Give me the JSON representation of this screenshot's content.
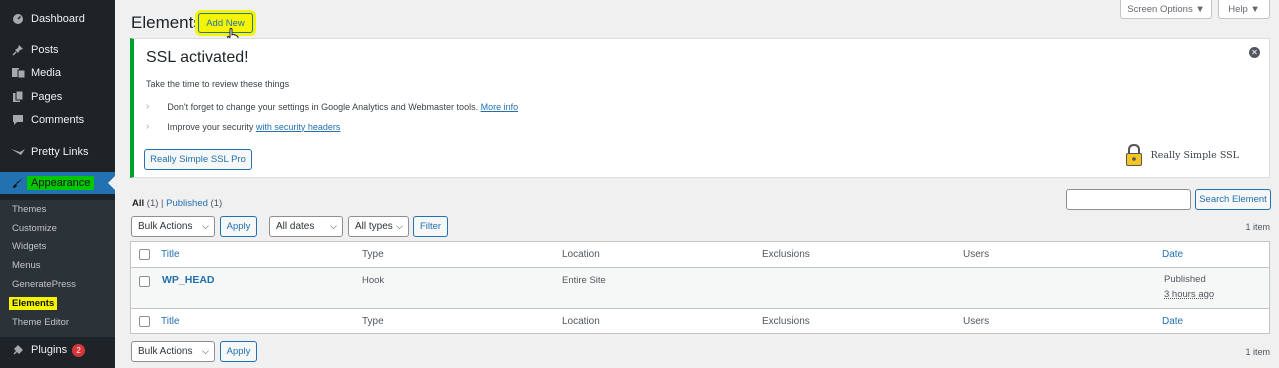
{
  "sidebar": {
    "items": [
      {
        "label": "Dashboard",
        "icon": "dashboard-icon"
      },
      {
        "label": "Posts",
        "icon": "pin-icon"
      },
      {
        "label": "Media",
        "icon": "media-icon"
      },
      {
        "label": "Pages",
        "icon": "pages-icon"
      },
      {
        "label": "Comments",
        "icon": "comment-icon"
      },
      {
        "label": "Pretty Links",
        "icon": "pretty-links-icon"
      },
      {
        "label": "Appearance",
        "icon": "brush-icon"
      },
      {
        "label": "Plugins",
        "icon": "plugins-icon",
        "badge": "2"
      }
    ],
    "submenu": [
      "Themes",
      "Customize",
      "Widgets",
      "Menus",
      "GeneratePress",
      "Elements",
      "Theme Editor"
    ]
  },
  "header": {
    "title": "Elements",
    "add_new": "Add New",
    "screen_options": "Screen Options ▼",
    "help": "Help ▼"
  },
  "notice": {
    "title": "SSL activated!",
    "intro": "Take the time to review these things",
    "line1_text": "Don't forget to change your settings in Google Analytics and Webmaster tools.",
    "line1_link": "More info",
    "line2_text": "Improve your security",
    "line2_link": "with security headers",
    "button": "Really Simple SSL Pro",
    "brand": "Really Simple SSL"
  },
  "filters": {
    "all_label": "All",
    "all_count": "(1)",
    "separator": "|",
    "published_label": "Published",
    "published_count": "(1)",
    "bulk_actions": "Bulk Actions",
    "apply": "Apply",
    "all_dates": "All dates",
    "all_types": "All types",
    "filter": "Filter",
    "search_button": "Search Element",
    "items_count": "1 item"
  },
  "table": {
    "columns": [
      "Title",
      "Type",
      "Location",
      "Exclusions",
      "Users",
      "Date"
    ],
    "rows": [
      {
        "title": "WP_HEAD",
        "type": "Hook",
        "location": "Entire Site",
        "exclusions": "",
        "users": "",
        "date_status": "Published",
        "date_time": "3 hours ago"
      }
    ]
  },
  "bottom": {
    "bulk_actions": "Bulk Actions",
    "apply": "Apply",
    "items_count": "1 item"
  },
  "colors": {
    "sidebar_bg": "#1d2327",
    "accent": "#2271b1",
    "highlight_yellow": "#f5f500",
    "highlight_green": "#00c800",
    "notice_border": "#00a32a"
  }
}
